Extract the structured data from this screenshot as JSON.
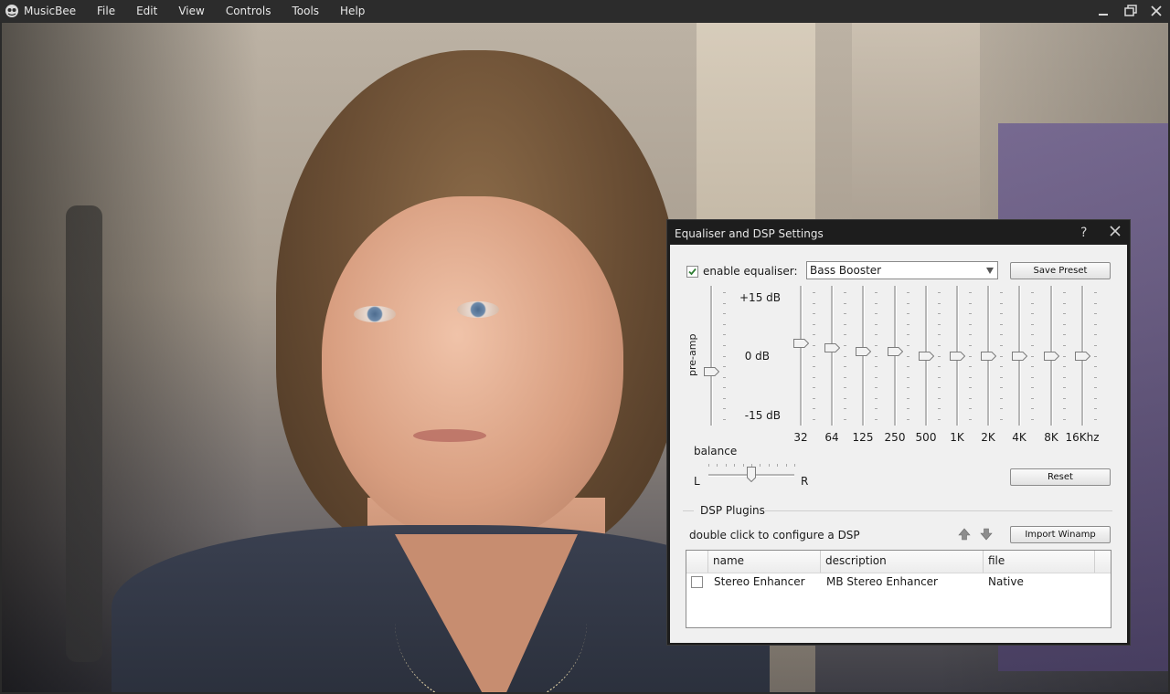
{
  "app": {
    "name": "MusicBee",
    "menu": [
      "File",
      "Edit",
      "View",
      "Controls",
      "Tools",
      "Help"
    ]
  },
  "dialog": {
    "title": "Equaliser and DSP Settings",
    "help": "?",
    "enable_equaliser": {
      "label": "enable equaliser:",
      "checked": true
    },
    "preset": {
      "selected": "Bass Booster"
    },
    "save_preset_label": "Save Preset",
    "reset_label": "Reset",
    "import_winamp_label": "Import Winamp",
    "preamp_label": "pre-amp",
    "db_labels": {
      "top": "+15 dB",
      "mid": "0 dB",
      "bottom": "-15 dB"
    },
    "balance": {
      "label": "balance",
      "left": "L",
      "right": "R",
      "value": 0
    },
    "preamp_value": -4,
    "bands": [
      {
        "freq": "32",
        "gain": 3
      },
      {
        "freq": "64",
        "gain": 2
      },
      {
        "freq": "125",
        "gain": 1
      },
      {
        "freq": "250",
        "gain": 1
      },
      {
        "freq": "500",
        "gain": 0
      },
      {
        "freq": "1K",
        "gain": 0
      },
      {
        "freq": "2K",
        "gain": 0
      },
      {
        "freq": "4K",
        "gain": 0
      },
      {
        "freq": "8K",
        "gain": 0
      },
      {
        "freq": "16Khz",
        "gain": 0
      }
    ],
    "dsp": {
      "group_label": "DSP Plugins",
      "hint": "double click to configure a DSP",
      "columns": [
        "name",
        "description",
        "file"
      ],
      "rows": [
        {
          "checked": false,
          "name": "Stereo Enhancer",
          "description": "MB Stereo Enhancer",
          "file": "Native"
        }
      ]
    }
  }
}
